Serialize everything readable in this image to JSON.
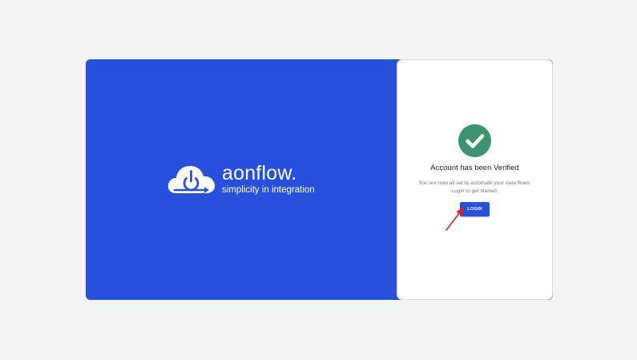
{
  "brand": {
    "name": "aonflow.",
    "tagline": "simplicity in integration",
    "logo_icon": "cloud-power-icon",
    "color": "#2751dc"
  },
  "verification": {
    "status_icon": "check-circle-icon",
    "status_color": "#3d9470",
    "title": "Account has been Verified",
    "message_line1": "You are now all set to automate your data flows.",
    "message_line2": "Login to get started.",
    "login_label": "LOGIN"
  },
  "annotation": {
    "arrow_icon": "red-arrow-icon",
    "color": "#e02020"
  }
}
